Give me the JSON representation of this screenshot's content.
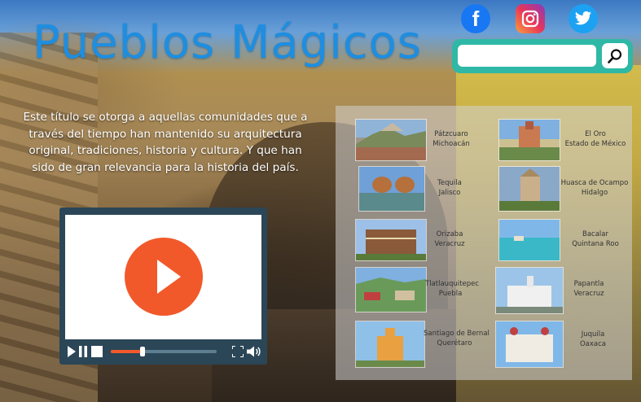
{
  "header": {
    "title": "Pueblos Mágicos"
  },
  "social": [
    {
      "name": "facebook",
      "icon": "facebook-icon",
      "glyph": "f",
      "color": "#1877f2"
    },
    {
      "name": "instagram",
      "icon": "instagram-icon",
      "color": "#e8355a"
    },
    {
      "name": "twitter",
      "icon": "twitter-icon",
      "color": "#1da1f2"
    }
  ],
  "search": {
    "placeholder": "",
    "value": "",
    "button_icon": "magnifier-icon",
    "accent": "#2fb8a6"
  },
  "description": "Este título se otorga a aquellas comunidades que a través del tiempo han mantenido su arquitectura original, tradiciones, historia y cultura. Y que han sido de gran relevancia para la historia del país.",
  "video": {
    "play_icon": "play-icon",
    "progress": 0.3,
    "accent": "#f2592a",
    "frame_color": "#2b4657",
    "controls": [
      "play-icon",
      "pause-icon",
      "stop-icon",
      "fullscreen-icon",
      "volume-icon"
    ]
  },
  "pueblos": [
    {
      "line1": "Pátzcuaro",
      "line2": "Michoacán"
    },
    {
      "line1": "El Oro",
      "line2": "Estado de México"
    },
    {
      "line1": "Tequila",
      "line2": "Jalisco"
    },
    {
      "line1": "Huasca de Ocampo",
      "line2": "Hidalgo"
    },
    {
      "line1": "Orizaba",
      "line2": "Veracruz"
    },
    {
      "line1": "Bacalar",
      "line2": "Quintana Roo"
    },
    {
      "line1": "Tlatlauquitepec",
      "line2": "Puebla"
    },
    {
      "line1": "Papantla",
      "line2": "Veracruz"
    },
    {
      "line1": "Santiago de Bernal",
      "line2": "Querétaro"
    },
    {
      "line1": "Juquila",
      "line2": "Oaxaca"
    }
  ]
}
